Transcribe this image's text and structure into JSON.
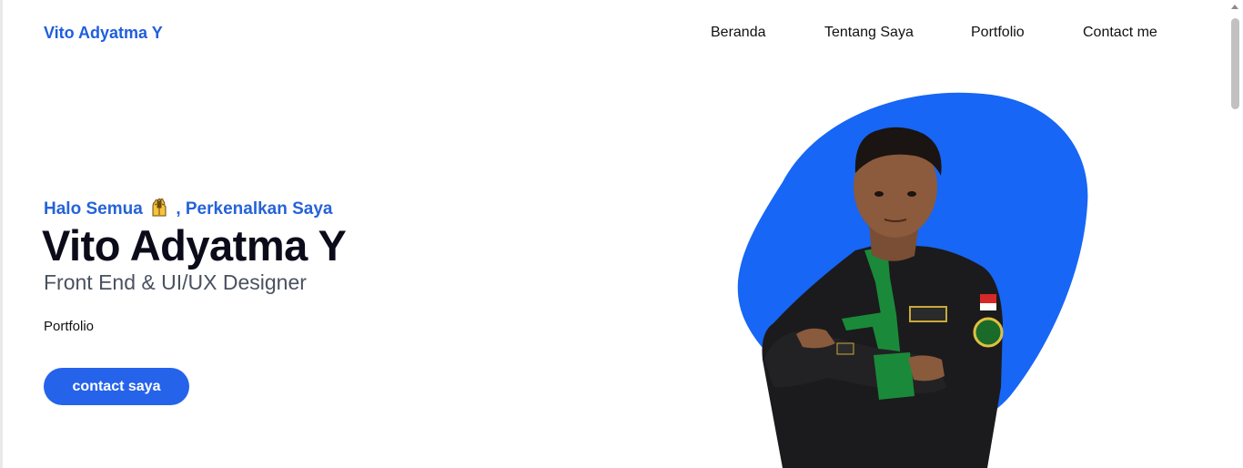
{
  "brand": {
    "name": "Vito Adyatma Y"
  },
  "nav": {
    "items": [
      {
        "label": "Beranda"
      },
      {
        "label": "Tentang Saya"
      },
      {
        "label": "Portfolio"
      },
      {
        "label": "Contact me"
      }
    ]
  },
  "hero": {
    "greeting_before": "Halo Semua",
    "greeting_icon": "raising-hands-icon",
    "greeting_after": ", Perkenalkan Saya",
    "name": "Vito Adyatma Y",
    "role": "Front End & UI/UX Designer",
    "portfolio_link": "Portfolio",
    "cta_label": "contact saya",
    "photo_icon": "profile-photo"
  },
  "colors": {
    "accent": "#2563eb",
    "brand_text": "#1f5ede",
    "blob": "#1766f5",
    "heading": "#0b0b1a"
  }
}
